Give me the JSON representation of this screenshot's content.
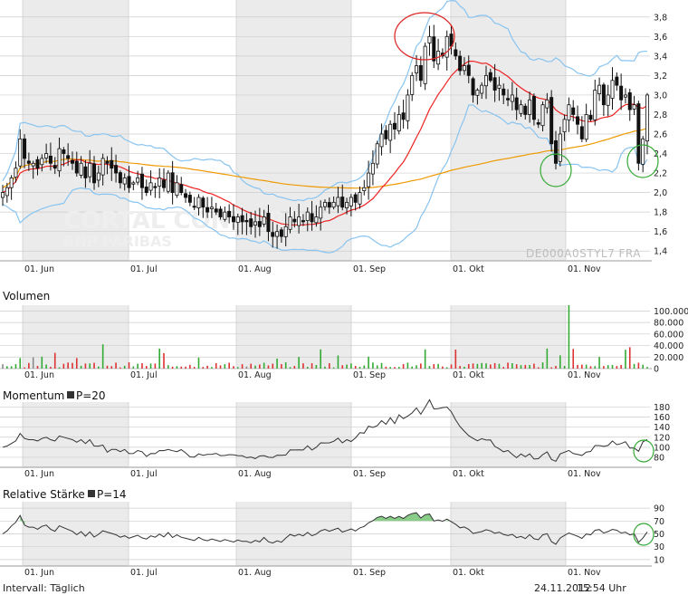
{
  "watermark": {
    "line1": "CORTAL CONSORS",
    "line2": "BNP PARIBAS"
  },
  "instrument_code": "DE000A0STYL7  FRA",
  "footer": {
    "interval": "Intervall: Täglich",
    "date": "24.11.2012",
    "time": "15:54 Uhr"
  },
  "colors": {
    "candle": "#111111",
    "price_line": "#ee2222",
    "sma200": "#ee9900",
    "bollinger": "#88c4f0",
    "volume_up": "#33aa33",
    "volume_down": "#dd3333",
    "volume_flat": "#888888",
    "indicator": "#333333",
    "rsi_fill": "#88cc88",
    "shade": "#ebebeb",
    "grid": "#cccccc",
    "annotation_red": "#dd2222",
    "annotation_green": "#33aa33"
  },
  "chart_data": [
    {
      "type": "candlestick",
      "panel": "price",
      "x_labels": [
        "01. Jun",
        "01. Jul",
        "01. Aug",
        "01. Sep",
        "01. Okt",
        "01. Nov"
      ],
      "ylim": [
        1.3,
        3.9
      ],
      "yticks": [
        "3,8",
        "3,6",
        "3,4",
        "3,2",
        "3,0",
        "2,8",
        "2,6",
        "2,4",
        "2,2",
        "2,0",
        "1,8",
        "1,6",
        "1,4"
      ],
      "ytick_values": [
        3.8,
        3.6,
        3.4,
        3.2,
        3.0,
        2.8,
        2.6,
        2.4,
        2.2,
        2.0,
        1.8,
        1.6,
        1.4
      ],
      "date_range": [
        "2012-05-22",
        "2012-11-23"
      ],
      "closes": [
        2.0,
        2.05,
        2.15,
        2.25,
        2.55,
        2.35,
        2.3,
        2.3,
        2.25,
        2.35,
        2.4,
        2.3,
        2.25,
        2.45,
        2.4,
        2.35,
        2.3,
        2.2,
        2.3,
        2.15,
        2.3,
        2.1,
        2.2,
        2.35,
        2.3,
        2.25,
        2.2,
        2.1,
        2.15,
        2.05,
        2.1,
        2.15,
        2.05,
        2.0,
        2.1,
        2.05,
        2.15,
        2.05,
        2.2,
        2.0,
        2.1,
        2.0,
        1.95,
        1.9,
        1.85,
        1.95,
        1.85,
        1.8,
        1.85,
        1.8,
        1.75,
        1.8,
        1.75,
        1.7,
        1.75,
        1.7,
        1.7,
        1.65,
        1.7,
        1.65,
        1.75,
        1.6,
        1.55,
        1.6,
        1.55,
        1.65,
        1.75,
        1.7,
        1.75,
        1.7,
        1.8,
        1.7,
        1.75,
        1.85,
        1.9,
        1.85,
        1.9,
        1.95,
        1.85,
        1.9,
        1.95,
        1.9,
        2.0,
        2.05,
        2.2,
        2.3,
        2.5,
        2.6,
        2.55,
        2.7,
        2.65,
        2.8,
        2.75,
        3.0,
        3.2,
        3.3,
        3.15,
        3.5,
        3.6,
        3.35,
        3.45,
        3.4,
        3.6,
        3.5,
        3.4,
        3.25,
        3.3,
        3.2,
        3.0,
        3.05,
        3.1,
        3.2,
        3.15,
        3.05,
        3.1,
        3.0,
        2.95,
        3.0,
        2.85,
        2.9,
        2.8,
        2.95,
        2.75,
        2.7,
        2.9,
        2.95,
        2.5,
        2.3,
        2.6,
        2.75,
        2.9,
        2.8,
        2.7,
        2.55,
        2.8,
        2.75,
        3.05,
        3.1,
        2.9,
        3.0,
        3.15,
        3.1,
        2.95,
        3.0,
        2.85,
        2.9,
        2.3,
        2.55,
        3.0
      ],
      "annotations": [
        {
          "shape": "ellipse",
          "color": "red",
          "around": "2012-09-19 high near 3,8"
        },
        {
          "shape": "circle",
          "color": "green",
          "around": "2012-10-25 low near 2,2"
        },
        {
          "shape": "circle",
          "color": "green",
          "around": "2012-11-21 low near 2,3"
        }
      ]
    },
    {
      "type": "bar",
      "panel": "volume",
      "title": "Volumen",
      "x_labels": [
        "01. Jun",
        "01. Jul",
        "01. Aug",
        "01. Sep",
        "01. Okt",
        "01. Nov"
      ],
      "ylim": [
        0,
        110000
      ],
      "yticks": [
        "100.000",
        "80.000",
        "60.000",
        "40.000",
        "20.000",
        "0"
      ],
      "ytick_values": [
        100000,
        80000,
        60000,
        40000,
        20000,
        0
      ],
      "spike": {
        "date": "2012-10-24",
        "value": 112000
      }
    },
    {
      "type": "line",
      "panel": "momentum",
      "title": "Momentum",
      "param": "P=20",
      "x_labels": [
        "01. Jun",
        "01. Jul",
        "01. Aug",
        "01. Sep",
        "01. Okt",
        "01. Nov"
      ],
      "ylim": [
        60,
        190
      ],
      "yticks": [
        "180",
        "160",
        "140",
        "120",
        "100",
        "80"
      ],
      "ytick_values": [
        180,
        160,
        140,
        120,
        100,
        80
      ],
      "annotation": {
        "shape": "circle",
        "color": "green",
        "around": "2012-11-23"
      }
    },
    {
      "type": "area",
      "panel": "rsi",
      "title": "Relative Stärke",
      "param": "P=14",
      "x_labels": [
        "01. Jun",
        "01. Jul",
        "01. Aug",
        "01. Sep",
        "01. Okt",
        "01. Nov"
      ],
      "ylim": [
        0,
        100
      ],
      "yticks": [
        "90",
        "70",
        "50",
        "30",
        "10"
      ],
      "ytick_values": [
        90,
        70,
        50,
        30,
        10
      ],
      "overbought_level": 70,
      "annotation": {
        "shape": "circle",
        "color": "green",
        "around": "2012-11-23"
      }
    }
  ]
}
